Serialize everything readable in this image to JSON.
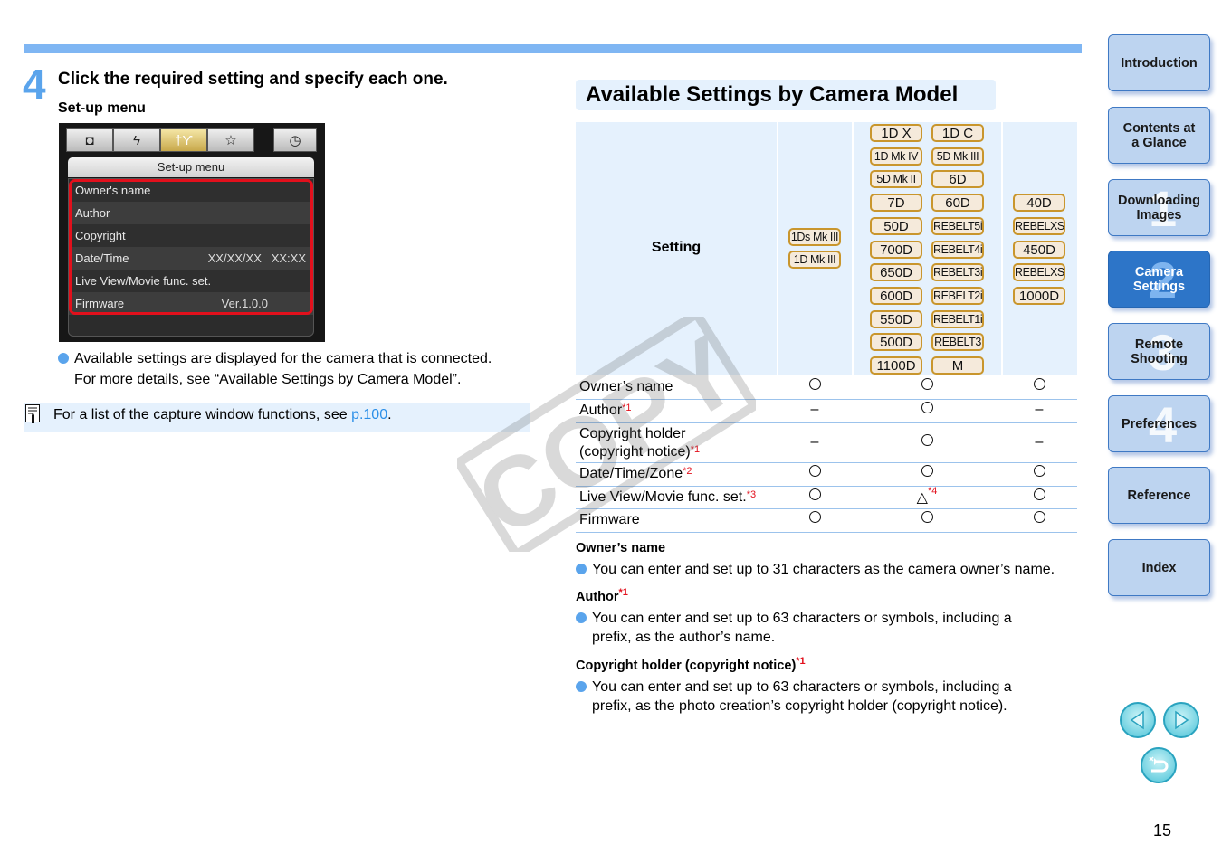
{
  "header": {
    "accent_bar_color": "#7fb6f3"
  },
  "step": {
    "number": "4",
    "title": "Click the required setting and specify each one.",
    "subtitle": "Set-up menu"
  },
  "camera_menu": {
    "tabs": [
      "camera-icon",
      "flash-icon",
      "setup-wrench-icon",
      "star-icon",
      "timer-icon"
    ],
    "tab_glyphs": [
      "◘",
      "ϟ",
      "†ϒ",
      "☆",
      "◷"
    ],
    "header": "Set-up menu",
    "items": [
      {
        "label": "Owner's name",
        "value": ""
      },
      {
        "label": "Author",
        "value": ""
      },
      {
        "label": "Copyright",
        "value": ""
      },
      {
        "label": "Date/Time",
        "value": "XX/XX/XX   XX:XX"
      },
      {
        "label": "Live View/Movie func. set.",
        "value": ""
      },
      {
        "label": "Firmware",
        "value": "Ver.1.0.0"
      }
    ]
  },
  "left_bullet": {
    "line1": "Available settings are displayed for the camera that is connected.",
    "line2": "For more details, see “Available Settings by Camera Model”."
  },
  "note": {
    "text": "For a list of the capture window functions, see ",
    "link": "p.100",
    "suffix": "."
  },
  "section_title": "Available Settings by Camera Model",
  "table": {
    "setting_header": "Setting",
    "col1_models": [
      "1Ds Mk III",
      "1D Mk III"
    ],
    "col2_models_left": [
      "1D X",
      "1D Mk IV",
      "5D Mk II",
      "7D",
      "50D",
      "700D",
      "650D",
      "600D",
      "550D",
      "500D",
      "1100D"
    ],
    "col2_models_right": [
      "1D C",
      "5D Mk III",
      "6D",
      "60D",
      "REBELT5i",
      "REBELT4i",
      "REBELT3i",
      "REBELT2i",
      "REBELT1i",
      "REBELT3",
      "M"
    ],
    "col3_models": [
      "40D",
      "REBELXSi",
      "450D",
      "REBELXS",
      "1000D"
    ],
    "rows": [
      {
        "setting": "Owner’s name",
        "note": "",
        "c1": "○",
        "c2": "○",
        "c2_note": "",
        "c3": "○"
      },
      {
        "setting": "Author",
        "note": "*1",
        "c1": "–",
        "c2": "○",
        "c2_note": "",
        "c3": "–"
      },
      {
        "setting": "Copyright holder",
        "setting2": "(copyright notice)",
        "note": "*1",
        "c1": "–",
        "c2": "○",
        "c2_note": "",
        "c3": "–"
      },
      {
        "setting": "Date/Time/Zone",
        "note": "*2",
        "c1": "○",
        "c2": "○",
        "c2_note": "",
        "c3": "○"
      },
      {
        "setting": "Live View/Movie func. set.",
        "note": "*3",
        "c1": "○",
        "c2": "△",
        "c2_note": "*4",
        "c3": "○"
      },
      {
        "setting": "Firmware",
        "note": "",
        "c1": "○",
        "c2": "○",
        "c2_note": "",
        "c3": "○"
      }
    ]
  },
  "descriptions": [
    {
      "heading": "Owner’s name",
      "note": "",
      "lines": [
        "You can enter and set up to 31 characters as the camera owner’s name."
      ]
    },
    {
      "heading": "Author",
      "note": "*1",
      "lines": [
        "You can enter and set up to 63 characters or symbols, including a",
        "prefix, as the author’s name."
      ]
    },
    {
      "heading": "Copyright holder (copyright notice)",
      "note": "*1",
      "lines": [
        "You can enter and set up to 63 characters or symbols, including a",
        "prefix, as the photo creation’s copyright holder (copyright notice)."
      ]
    }
  ],
  "nav": {
    "items": [
      {
        "label1": "Introduction",
        "label2": "",
        "num": ""
      },
      {
        "label1": "Contents at",
        "label2": "a Glance",
        "num": ""
      },
      {
        "label1": "Downloading",
        "label2": "Images",
        "num": "1"
      },
      {
        "label1": "Camera",
        "label2": "Settings",
        "num": "2",
        "active": true
      },
      {
        "label1": "Remote",
        "label2": "Shooting",
        "num": "3"
      },
      {
        "label1": "Preferences",
        "label2": "",
        "num": "4"
      },
      {
        "label1": "Reference",
        "label2": "",
        "num": ""
      },
      {
        "label1": "Index",
        "label2": "",
        "num": ""
      }
    ],
    "prev_icon": "previous-page-icon",
    "next_icon": "next-page-icon",
    "back_icon": "return-icon"
  },
  "watermark": "COPY",
  "page_number": "15",
  "colors": {
    "accent": "#5aa4ec",
    "link": "#2b8fe8",
    "footnote": "#e2101c",
    "panel": "#e5f1fd",
    "nav_active": "#2d75c8"
  }
}
